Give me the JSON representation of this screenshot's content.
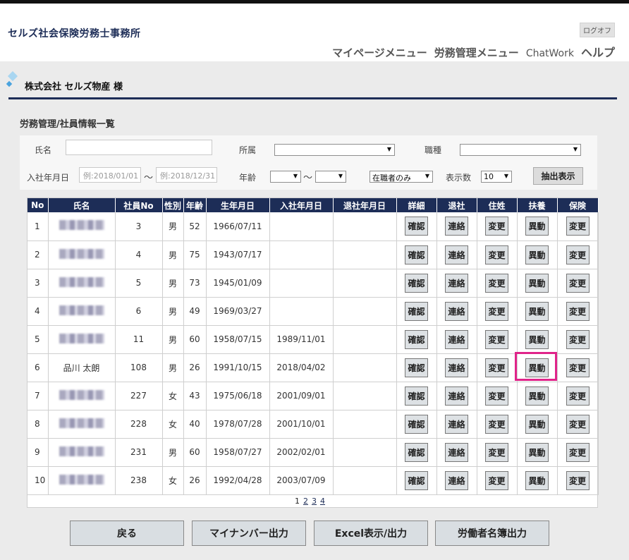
{
  "header": {
    "brand": "セルズ社会保険労務士事務所",
    "logout": "ログオフ",
    "nav": [
      "マイページメニュー",
      "労務管理メニュー",
      "ChatWork",
      "ヘルプ"
    ]
  },
  "company": {
    "name": "株式会社 セルズ物産 様"
  },
  "section_title": "労務管理/社員情報一覧",
  "filter": {
    "name_label": "氏名",
    "dept_label": "所属",
    "job_label": "職種",
    "hire_label": "入社年月日",
    "hire_from_placeholder": "例:2018/01/01",
    "tilde": "～",
    "hire_to_placeholder": "例:2018/12/31",
    "age_label": "年齢",
    "age_tilde": "～",
    "status_value": "在職者のみ",
    "count_label": "表示数",
    "count_value": "10",
    "extract_button": "抽出表示"
  },
  "table": {
    "headers": [
      "No",
      "氏名",
      "社員No",
      "性別",
      "年齢",
      "生年月日",
      "入社年月日",
      "退社年月日",
      "詳細",
      "退社",
      "住姓",
      "扶養",
      "保険"
    ],
    "buttons": {
      "detail": "確認",
      "retire": "連絡",
      "address": "変更",
      "dependents": "異動",
      "insurance": "変更"
    },
    "rows": [
      {
        "no": "1",
        "name": "",
        "emp_no": "3",
        "gender": "男",
        "age": "52",
        "birth": "1966/07/11",
        "hire": "",
        "retire": ""
      },
      {
        "no": "2",
        "name": "",
        "emp_no": "4",
        "gender": "男",
        "age": "75",
        "birth": "1943/07/17",
        "hire": "",
        "retire": ""
      },
      {
        "no": "3",
        "name": "",
        "emp_no": "5",
        "gender": "男",
        "age": "73",
        "birth": "1945/01/09",
        "hire": "",
        "retire": ""
      },
      {
        "no": "4",
        "name": "",
        "emp_no": "6",
        "gender": "男",
        "age": "49",
        "birth": "1969/03/27",
        "hire": "",
        "retire": ""
      },
      {
        "no": "5",
        "name": "",
        "emp_no": "11",
        "gender": "男",
        "age": "60",
        "birth": "1958/07/15",
        "hire": "1989/11/01",
        "retire": ""
      },
      {
        "no": "6",
        "name": "品川 太朗",
        "emp_no": "108",
        "gender": "男",
        "age": "26",
        "birth": "1991/10/15",
        "hire": "2018/04/02",
        "retire": ""
      },
      {
        "no": "7",
        "name": "",
        "emp_no": "227",
        "gender": "女",
        "age": "43",
        "birth": "1975/06/18",
        "hire": "2001/09/01",
        "retire": ""
      },
      {
        "no": "8",
        "name": "",
        "emp_no": "228",
        "gender": "女",
        "age": "40",
        "birth": "1978/07/28",
        "hire": "2001/10/01",
        "retire": ""
      },
      {
        "no": "9",
        "name": "",
        "emp_no": "231",
        "gender": "男",
        "age": "60",
        "birth": "1958/07/27",
        "hire": "2002/02/01",
        "retire": ""
      },
      {
        "no": "10",
        "name": "",
        "emp_no": "238",
        "gender": "女",
        "age": "26",
        "birth": "1992/04/28",
        "hire": "2003/07/09",
        "retire": ""
      }
    ]
  },
  "pager": {
    "current": "1",
    "pages": [
      "2",
      "3",
      "4"
    ]
  },
  "bottom_buttons": [
    "戻る",
    "マイナンバー出力",
    "Excel表示/出力",
    "労働者名簿出力"
  ]
}
